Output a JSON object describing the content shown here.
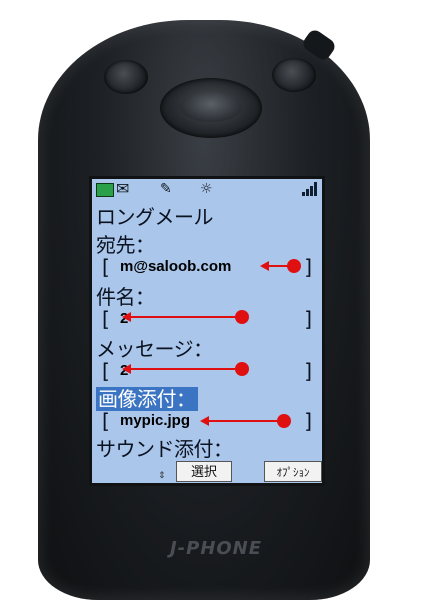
{
  "status_bar": {
    "icons": [
      "battery-icon",
      "mail-icon",
      "pen-icon",
      "sun-icon",
      "signal-icon"
    ]
  },
  "screen": {
    "title": "ロングメール",
    "to_label": "宛先：",
    "to_value": "m@saloob.com",
    "subject_label": "件名：",
    "subject_value": "2",
    "message_label": "メッセージ：",
    "message_value": "2",
    "image_label": "画像添付：",
    "image_value": "mypic.jpg",
    "sound_label": "サウンド添付："
  },
  "softkeys": {
    "select": "選択",
    "option": "ｵﾌﾟｼｮﾝ"
  },
  "bracket_open": "[",
  "bracket_close": "]",
  "brand": "J-PHONE",
  "colors": {
    "screen_bg": "#aac6ea",
    "highlight": "#3b74c3",
    "annotation_red": "#e01010"
  }
}
